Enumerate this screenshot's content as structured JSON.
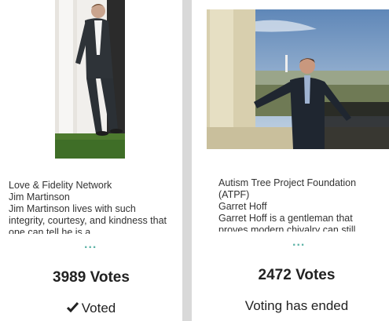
{
  "cards": [
    {
      "organization": "Love & Fidelity Network",
      "name": "Jim Martinson",
      "description": "Jim Martinson lives with such integrity, courtesy, and kindness that one can tell he is a",
      "more": "...",
      "votes": "3989 Votes",
      "status": "Voted",
      "status_icon": "check-icon"
    },
    {
      "organization": "Autism Tree Project Foundation (ATPF)",
      "name": "Garret Hoff",
      "description": "Garret Hoff is a gentleman that proves modern chivalry can still",
      "more": "...",
      "votes": "2472 Votes",
      "status": "Voting has ended"
    }
  ],
  "colors": {
    "accent": "#5fb4a8",
    "background": "#d9d9d9",
    "card": "#ffffff"
  }
}
